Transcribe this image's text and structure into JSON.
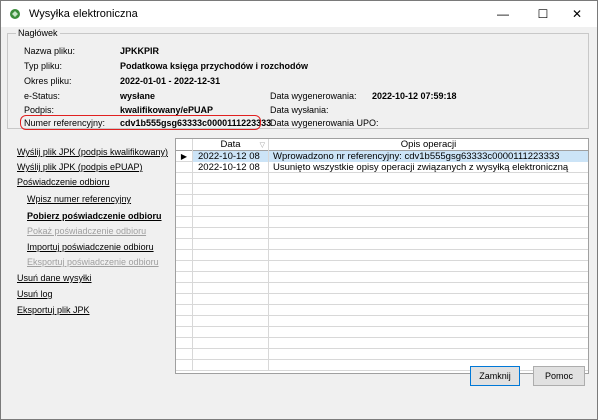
{
  "window": {
    "title": "Wysyłka elektroniczna",
    "min_glyph": "—",
    "max_glyph": "☐",
    "close_glyph": "✕"
  },
  "header_group": {
    "legend": "Nagłówek",
    "file_name_label": "Nazwa pliku:",
    "file_name_value": "JPKKPIR",
    "file_type_label": "Typ pliku:",
    "file_type_value": "Podatkowa księga przychodów i rozchodów",
    "period_label": "Okres pliku:",
    "period_value": "2022-01-01 - 2022-12-31",
    "status_label": "e-Status:",
    "status_value": "wysłane",
    "signature_label": "Podpis:",
    "signature_value": "kwalifikowany/ePUAP",
    "ref_label": "Numer referencyjny:",
    "ref_value": "cdv1b555gsg63333c0000111223333",
    "generated_label": "Data wygenerowania:",
    "generated_value": "2022-10-12 07:59:18",
    "sent_label": "Data wysłania:",
    "sent_value": "",
    "upo_label": "Data wygenerowania UPO:",
    "upo_value": ""
  },
  "sidebar": {
    "items": [
      {
        "label": "Wyślij plik JPK (podpis kwalifikowany)"
      },
      {
        "label": "Wyślij plik JPK (podpis ePUAP)"
      },
      {
        "label": "Poświadczenie odbioru"
      },
      {
        "label": "Wpisz numer referencyjny"
      },
      {
        "label": "Pobierz poświadczenie odbioru"
      },
      {
        "label": "Pokaż poświadczenie odbioru"
      },
      {
        "label": "Importuj poświadczenie odbioru"
      },
      {
        "label": "Eksportuj poświadczenie odbioru"
      },
      {
        "label": "Usuń dane wysyłki"
      },
      {
        "label": "Usuń log"
      },
      {
        "label": "Eksportuj plik JPK"
      }
    ]
  },
  "grid": {
    "columns": [
      "Data",
      "Opis operacji"
    ],
    "rows": [
      {
        "indicator": "▶",
        "date": "2022-10-12 08",
        "desc": "Wprowadzono nr referencyjny: cdv1b555gsg63333c0000111223333"
      },
      {
        "indicator": "",
        "date": "2022-10-12 08",
        "desc": "Usunięto wszystkie opisy operacji związanych z wysyłką elektroniczną"
      }
    ]
  },
  "buttons": {
    "close": "Zamknij",
    "help": "Pomoc"
  },
  "colors": {
    "selection": "#cce4f7",
    "highlight": "#e02020",
    "disabled_text": "#a0a0a0"
  }
}
